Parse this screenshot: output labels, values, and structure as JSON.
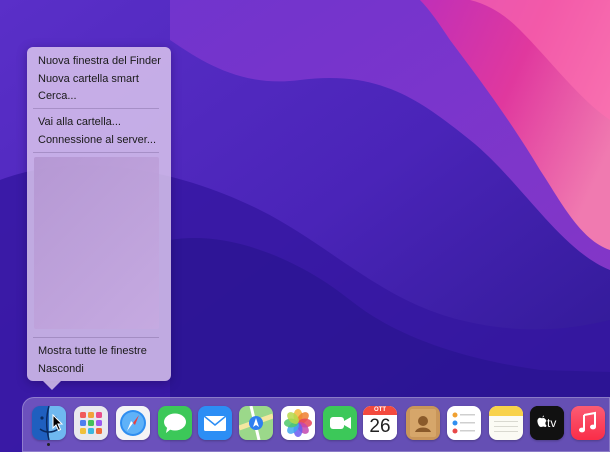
{
  "context_menu": {
    "items_group1": [
      "Nuova finestra del Finder",
      "Nuova cartella smart",
      "Cerca..."
    ],
    "items_group2": [
      "Vai alla cartella...",
      "Connessione al server..."
    ],
    "items_group3": [
      "Mostra tutte le finestre",
      "Nascondi"
    ]
  },
  "dock": {
    "apps": [
      {
        "name": "Finder",
        "icon": "finder-icon"
      },
      {
        "name": "Launchpad",
        "icon": "launchpad-icon"
      },
      {
        "name": "Safari",
        "icon": "safari-icon"
      },
      {
        "name": "Messaggi",
        "icon": "messages-icon"
      },
      {
        "name": "Mail",
        "icon": "mail-icon"
      },
      {
        "name": "Mappe",
        "icon": "maps-icon"
      },
      {
        "name": "Foto",
        "icon": "photos-icon"
      },
      {
        "name": "FaceTime",
        "icon": "facetime-icon"
      },
      {
        "name": "Calendario",
        "icon": "calendar-icon"
      },
      {
        "name": "Contatti",
        "icon": "contacts-icon"
      },
      {
        "name": "Promemoria",
        "icon": "reminders-icon"
      },
      {
        "name": "Note",
        "icon": "notes-icon"
      },
      {
        "name": "Apple TV",
        "icon": "apple-tv-icon"
      },
      {
        "name": "Musica",
        "icon": "music-icon"
      }
    ],
    "calendar": {
      "month": "OTT",
      "day": "26"
    },
    "tv_label": "tv"
  },
  "colors": {
    "wallpaper_base": "#3a1fa8",
    "wallpaper_pink": "#e23aa6",
    "menu_bg": "#e2cef0"
  }
}
